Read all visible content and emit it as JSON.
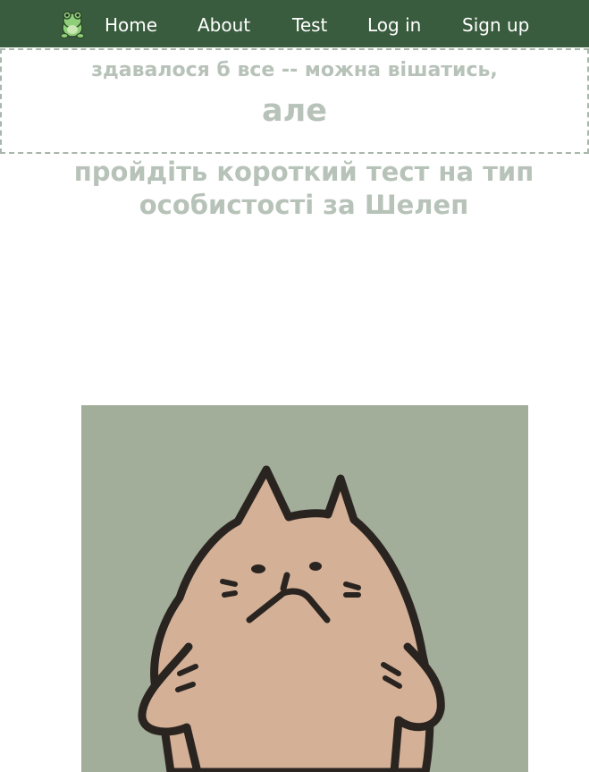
{
  "nav": {
    "logo_icon": "frog-icon",
    "items": [
      {
        "label": "Home"
      },
      {
        "label": "About"
      },
      {
        "label": "Test"
      },
      {
        "label": "Log in"
      },
      {
        "label": "Sign up"
      }
    ]
  },
  "banner": {
    "line1": "здавалося б все -- можна вішатись,",
    "line2": "але"
  },
  "subtitle": {
    "line1": "пройдіть короткий тест на тип",
    "line2": "особистості за Шелеп"
  },
  "image": {
    "icon": "cat-illustration",
    "background": "#a2ad9a",
    "cat_color": "#d4b097",
    "outline": "#2a2420"
  },
  "colors": {
    "nav_bg": "#3a5c3e",
    "text_muted": "#b7c2b8",
    "border_dashed": "#a9b6ab"
  }
}
